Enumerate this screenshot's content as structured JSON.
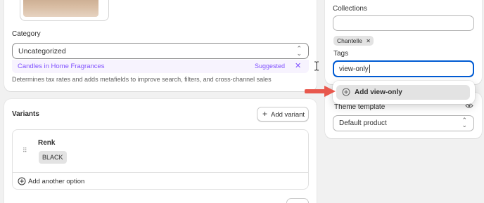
{
  "product": {
    "category_label": "Category",
    "category_value": "Uncategorized",
    "suggestion_text": "Candles in Home Fragrances",
    "suggestion_badge": "Suggested",
    "suggestion_dismiss": "✕",
    "help_text": "Determines tax rates and adds metafields to improve search, filters, and cross-channel sales"
  },
  "variants": {
    "title": "Variants",
    "add_variant_label": "Add variant",
    "option_name": "Renk",
    "option_values": [
      "BLACK"
    ],
    "add_option_label": "Add another option"
  },
  "organization": {
    "collections_label": "Collections",
    "collections_value": "",
    "collection_tags": [
      "Chantelle"
    ],
    "tags_label": "Tags",
    "tags_input_value": "view-only",
    "dropdown_option_label": "Add view-only",
    "theme_template_label": "Theme template",
    "theme_template_value": "Default product"
  },
  "colors": {
    "accent_purple": "#8051ff",
    "arrow": "#e8584d",
    "focus_ring": "#005bd3"
  },
  "icons": [
    "chevron-up-down-icon",
    "close-icon",
    "plus-icon",
    "drag-handle-icon",
    "plus-circle-icon",
    "eye-icon",
    "arrow-pointer-icon",
    "text-cursor-icon"
  ]
}
